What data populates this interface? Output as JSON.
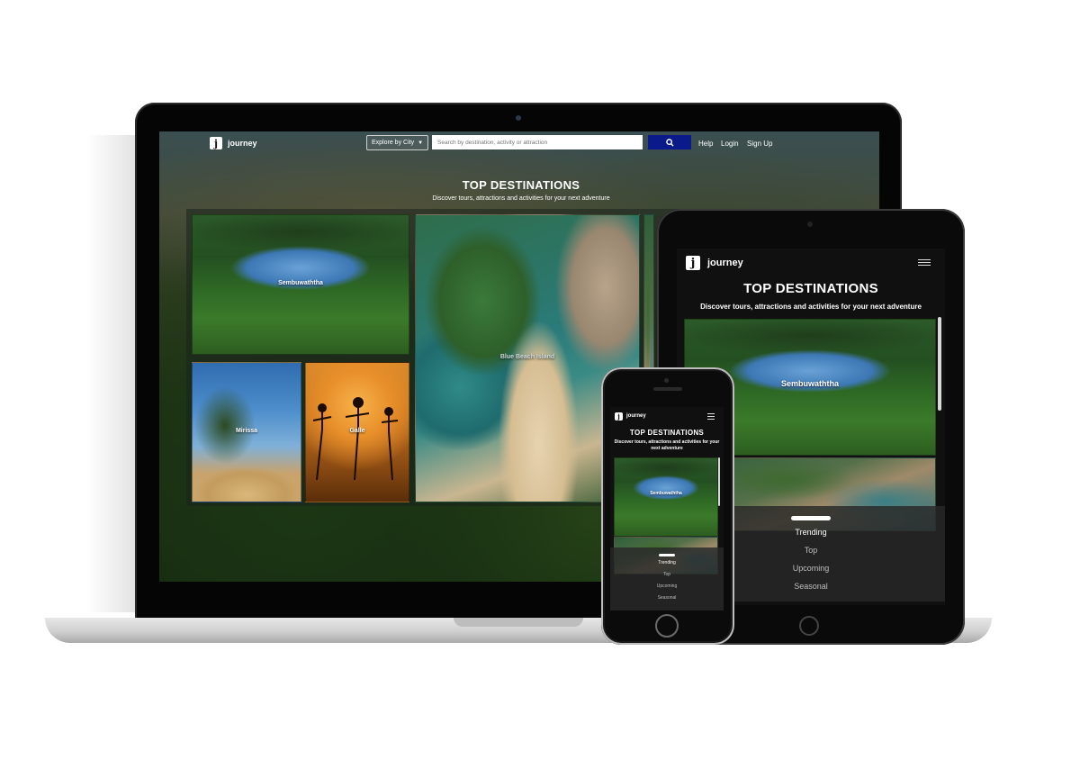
{
  "brand": {
    "logo_letter": "j",
    "name": "journey"
  },
  "nav": {
    "explore_label": "Explore by City",
    "search_placeholder": "Search by destination, activity or attraction",
    "links": [
      "Help",
      "Login",
      "Sign Up"
    ]
  },
  "hero": {
    "title": "TOP DESTINATIONS",
    "subtitle": "Discover tours, attractions and activities for your next adventure"
  },
  "destinations": [
    "Sembuwaththa",
    "Blue Beach Island",
    "Mirissa",
    "Galle"
  ],
  "menu": {
    "items": [
      "Trending",
      "Top",
      "Upcoming",
      "Seasonal"
    ],
    "active": "Trending"
  },
  "icons": {
    "search": "search-icon",
    "dropdown": "caret-down-icon",
    "menu": "hamburger-menu-icon"
  },
  "colors": {
    "search_button": "#0a1a8a",
    "text": "#ffffff"
  }
}
